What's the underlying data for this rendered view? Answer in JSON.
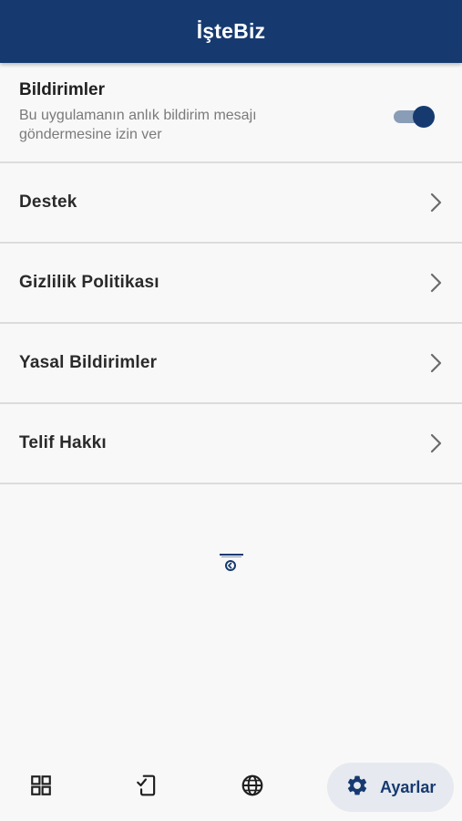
{
  "app_bar": {
    "title": "İşteBiz"
  },
  "notifications": {
    "title": "Bildirimler",
    "subtitle": "Bu uygulamanın anlık bildirim mesajı göndermesine izin ver",
    "enabled": true
  },
  "menu": [
    {
      "label": "Destek",
      "icon": "chevron-right-icon"
    },
    {
      "label": "Gizlilik Politikası",
      "icon": "chevron-right-icon"
    },
    {
      "label": "Yasal Bildirimler",
      "icon": "chevron-right-icon"
    },
    {
      "label": "Telif Hakkı",
      "icon": "chevron-right-icon"
    }
  ],
  "bottom_nav": {
    "items": [
      {
        "icon": "grid-icon"
      },
      {
        "icon": "device-check-icon"
      },
      {
        "icon": "globe-icon"
      },
      {
        "icon": "gear-icon",
        "label": "Ayarlar",
        "active": true
      }
    ]
  },
  "colors": {
    "primary": "#163a70",
    "toggle_track": "#8a9db7",
    "active_pill": "#e6e9ef",
    "background": "#f8f8f8"
  }
}
